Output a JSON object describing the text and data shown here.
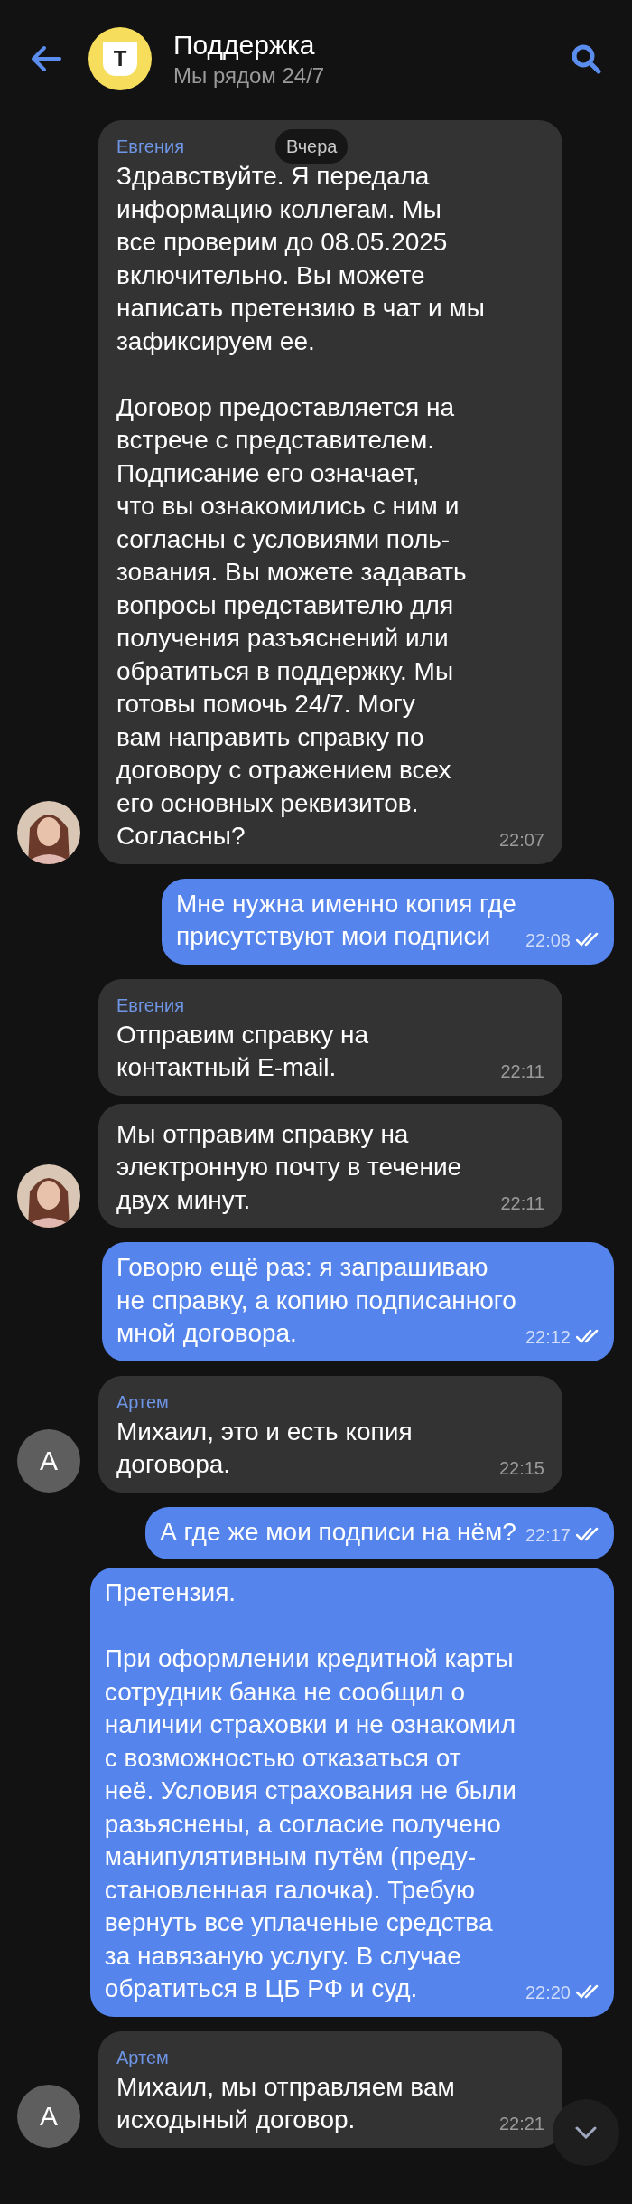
{
  "header": {
    "logo_text": "Т",
    "title": "Поддержка",
    "subtitle": "Мы рядом 24/7"
  },
  "date_badge": "Вчера",
  "messages": [
    {
      "kind": "incoming",
      "sender": "Евгения",
      "text": "Здравствуйте. Я передала\nинформацию коллегам. Мы\nвсе проверим до 08.05.2025\nвключительно. Вы можете\nнаписать претензию в чат и мы\nзафиксируем ее.\n\nДоговор предоставляется на\nвстрече с представителем.\nПодписание его означает,\nчто вы ознакомились с ним и\nсогласны с условиями поль-\nзования. Вы можете задавать\nвопросы представителю для\nполучения разъяснений или\nобратиться в поддержку. Мы\nготовы помочь 24/7. Могу\nвам направить справку по\nдоговору с отражением всех\nего основных реквизитов.\nСогласны?",
      "time": "22:07"
    },
    {
      "kind": "outgoing",
      "text": "Мне нужна именно копия где\nприсутствуют мои подписи",
      "time": "22:08",
      "read": true
    },
    {
      "kind": "incoming",
      "sender": "Евгения",
      "text": "Отправим справку на\nконтактный E-mail.",
      "time": "22:11"
    },
    {
      "kind": "incoming",
      "text": "Мы отправим справку на\nэлектронную почту в течение\nдвух минут.",
      "time": "22:11"
    },
    {
      "kind": "outgoing",
      "text": "Говорю ещё раз: я запрашиваю\nне справку, а копию подписанного\nмной договора.",
      "time": "22:12",
      "read": true
    },
    {
      "kind": "incoming",
      "sender": "Артем",
      "text": "Михаил, это и есть копия\nдоговора.",
      "time": "22:15",
      "avatar": {
        "kind": "letter",
        "letter": "А"
      }
    },
    {
      "kind": "outgoing",
      "text": "А где же мои подписи на нём?",
      "time": "22:17",
      "read": true
    },
    {
      "kind": "outgoing",
      "text": "Претензия.\n\nПри оформлении кредитной карты\nсотрудник банка не сообщил о\nналичии страховки и не ознакомил\nс возможностью отказаться от\nнеё. Условия страхования не были\nразьяснены, а согласие получено\nманипулятивным путём (преду-\nстановленная галочка). Требую\nвернуть все уплаченые средства\nза навязаную услугу. В случае\nобратиться в ЦБ РФ и суд.",
      "time": "22:20",
      "read": true
    },
    {
      "kind": "incoming",
      "sender": "Артем",
      "text": "Михаил, мы отправляем вам\nисходыный договор.",
      "time": "22:21",
      "avatar": {
        "kind": "letter",
        "letter": "А"
      }
    }
  ]
}
